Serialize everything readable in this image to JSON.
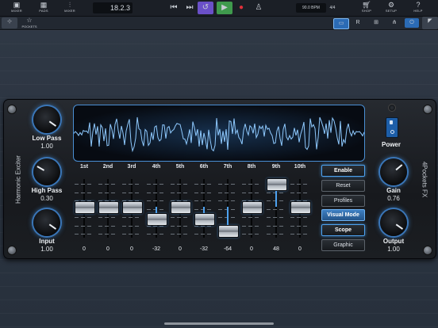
{
  "toolbar": {
    "items": [
      {
        "label": "MIXER",
        "icon": "mixer-icon"
      },
      {
        "label": "PADS",
        "icon": "pads-icon"
      },
      {
        "label": "MIXER",
        "icon": "sliders-icon"
      }
    ],
    "position": "18.2.3",
    "tempo": "90.0 BPM",
    "time_signature": "4/4",
    "right_items": [
      {
        "label": "SHOP",
        "icon": "cart-icon"
      },
      {
        "label": "SETUP",
        "icon": "gear-icon"
      },
      {
        "label": "HELP",
        "icon": "help-icon"
      }
    ]
  },
  "secondary_bar": {
    "pockets_label": "POCKETS",
    "buttons": [
      "R",
      "grid",
      "fx",
      "power"
    ]
  },
  "plugin": {
    "name": "Harmonic Exciter",
    "brand": "4Pockets FX",
    "knobs": {
      "low_pass": {
        "label": "Low Pass",
        "value": "1.00"
      },
      "high_pass": {
        "label": "High Pass",
        "value": "0.30"
      },
      "input": {
        "label": "Input",
        "value": "1.00"
      },
      "gain": {
        "label": "Gain",
        "value": "0.76"
      },
      "output": {
        "label": "Output",
        "value": "1.00"
      }
    },
    "power_label": "Power",
    "harmonics": [
      {
        "label": "1st",
        "value": "0"
      },
      {
        "label": "2nd",
        "value": "0"
      },
      {
        "label": "3rd",
        "value": "0"
      },
      {
        "label": "4th",
        "value": "-32"
      },
      {
        "label": "5th",
        "value": "0"
      },
      {
        "label": "6th",
        "value": "-32"
      },
      {
        "label": "7th",
        "value": "-64"
      },
      {
        "label": "8th",
        "value": "0"
      },
      {
        "label": "9th",
        "value": "48"
      },
      {
        "label": "10th",
        "value": "0"
      }
    ],
    "buttons": {
      "enable": "Enable",
      "reset": "Reset",
      "profiles": "Profiles",
      "visual_mode": "Visual Mode",
      "scope": "Scope",
      "graphic": "Graphic"
    },
    "colors": {
      "accent": "#4da2f0",
      "panel": "#1b1e22",
      "power": "#1d5ea8"
    }
  }
}
